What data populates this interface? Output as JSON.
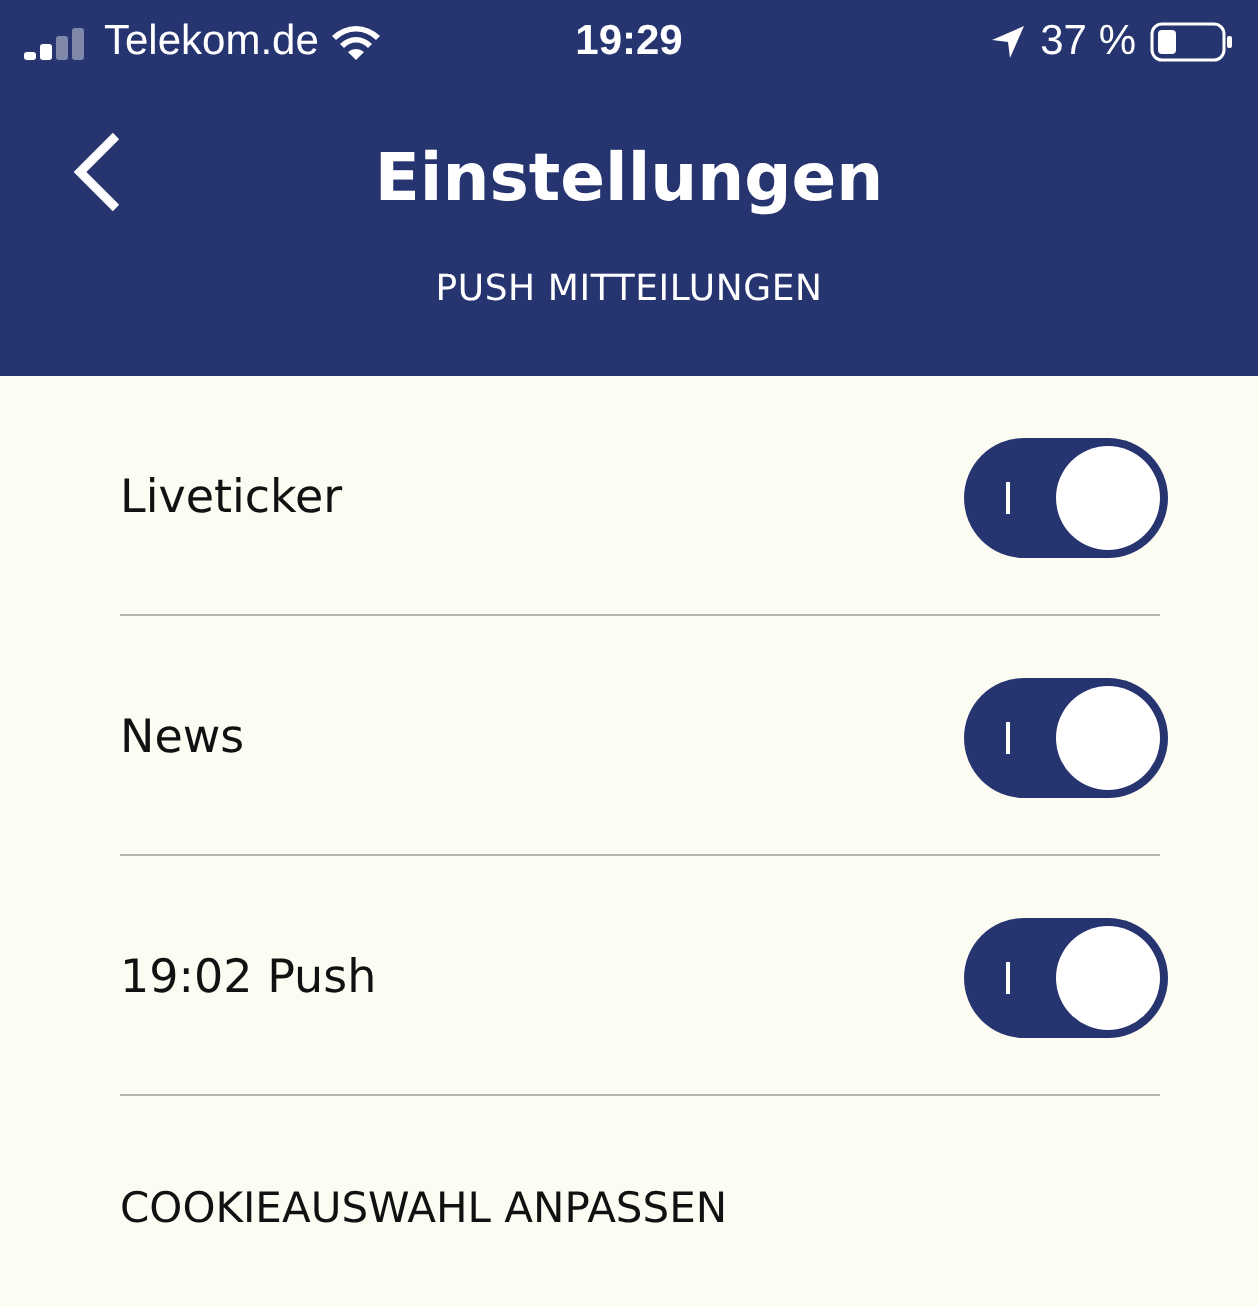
{
  "status_bar": {
    "carrier": "Telekom.de",
    "time": "19:29",
    "battery": "37 %"
  },
  "header": {
    "title": "Einstellungen",
    "subtitle": "PUSH MITTEILUNGEN"
  },
  "settings": [
    {
      "kind": "toggle",
      "label": "Liveticker",
      "on": true
    },
    {
      "kind": "toggle",
      "label": "News",
      "on": true
    },
    {
      "kind": "toggle",
      "label": "19:02 Push",
      "on": true
    },
    {
      "kind": "link",
      "label": "COOKIEAUSWAHL ANPASSEN"
    }
  ]
}
